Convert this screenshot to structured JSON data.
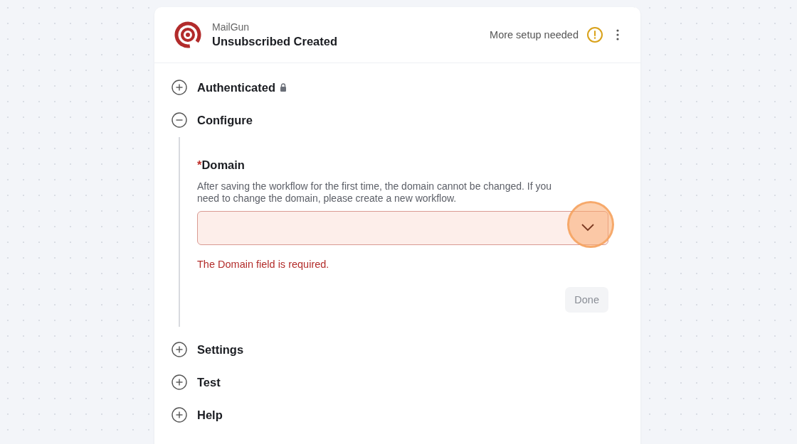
{
  "header": {
    "app": "MailGun",
    "title": "Unsubscribed Created",
    "status": "More setup needed",
    "warning": true
  },
  "sections": [
    {
      "title": "Authenticated",
      "expanded": false,
      "locked": true
    },
    {
      "title": "Configure",
      "expanded": true,
      "locked": false
    },
    {
      "title": "Settings",
      "expanded": false,
      "locked": false
    },
    {
      "title": "Test",
      "expanded": false,
      "locked": false
    },
    {
      "title": "Help",
      "expanded": false,
      "locked": false
    }
  ],
  "field": {
    "label": "Domain",
    "required": true,
    "required_mark": "*",
    "help": "After saving the workflow for the first time, the domain cannot be changed. If you need to change the domain, please create a new workflow.",
    "error": "The Domain field is required.",
    "highlighted": true
  },
  "done_button": {
    "label": "Done",
    "disabled": true
  }
}
